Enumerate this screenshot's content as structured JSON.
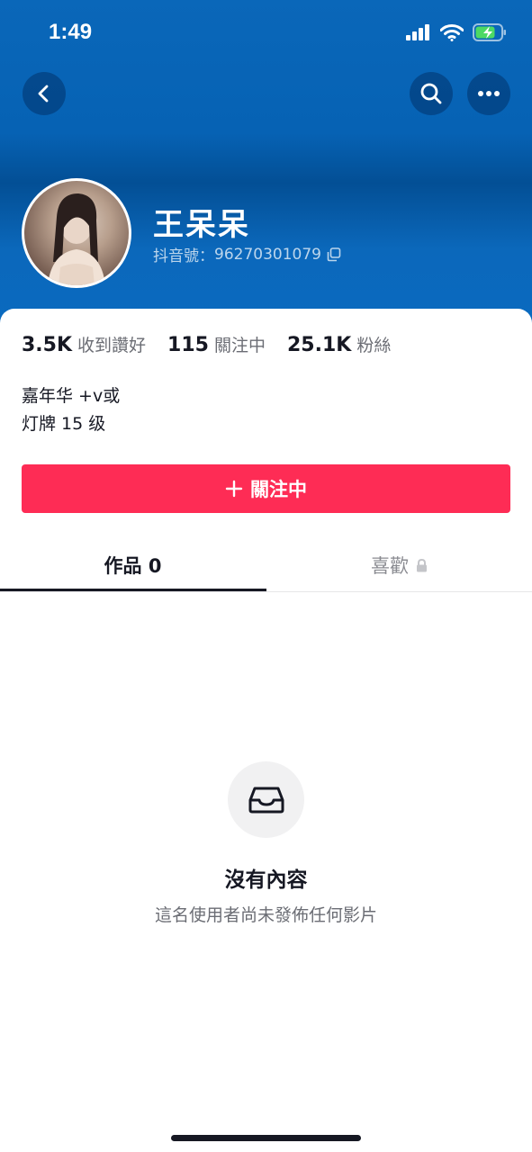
{
  "status_bar": {
    "time": "1:49"
  },
  "profile": {
    "name": "王呆呆",
    "douyin_id_label": "抖音號：",
    "douyin_id": "96270301079"
  },
  "stats": [
    {
      "value": "3.5K",
      "label": "收到讚好"
    },
    {
      "value": "115",
      "label": "關注中"
    },
    {
      "value": "25.1K",
      "label": "粉絲"
    }
  ],
  "bio": {
    "line1": "嘉年华 +v或",
    "line2": "灯牌 15 级"
  },
  "follow_button": {
    "label": "關注中"
  },
  "tabs": {
    "works_label": "作品 0",
    "likes_label": "喜歡"
  },
  "empty_state": {
    "title": "沒有內容",
    "description": "這名使用者尚未發佈任何影片"
  },
  "colors": {
    "header_blue": "#0a67b9",
    "follow_red": "#fe2c55"
  },
  "icons": {
    "back": "chevron-left-icon",
    "search": "search-icon",
    "more": "more-horizontal-icon",
    "copy": "copy-icon",
    "plus": "plus-icon",
    "lock": "lock-icon",
    "inbox": "inbox-icon"
  }
}
